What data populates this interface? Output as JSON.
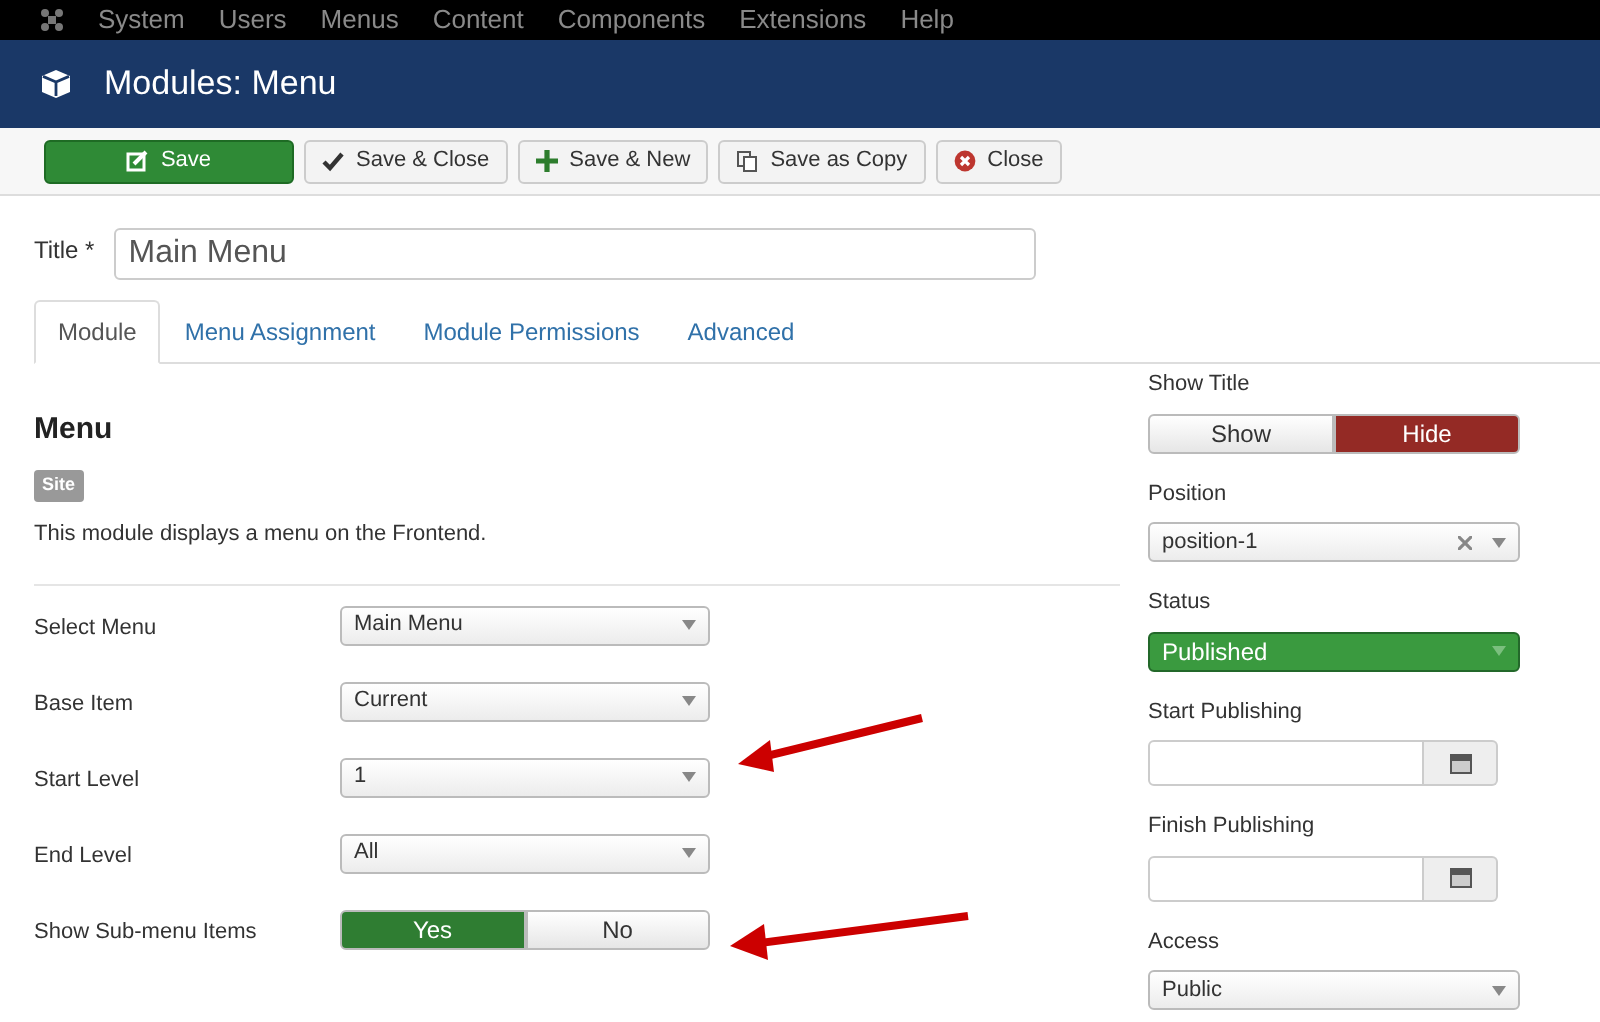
{
  "menu_bar": {
    "items": [
      "System",
      "Users",
      "Menus",
      "Content",
      "Components",
      "Extensions",
      "Help"
    ]
  },
  "header": {
    "title": "Modules: Menu"
  },
  "toolbar": {
    "buttons": [
      {
        "label": "Save",
        "kind": "primary"
      },
      {
        "label": "Save & Close",
        "kind": "default"
      },
      {
        "label": "Save & New",
        "kind": "default"
      },
      {
        "label": "Save as Copy",
        "kind": "default"
      },
      {
        "label": "Close",
        "kind": "default"
      }
    ]
  },
  "title_field": {
    "label": "Title *",
    "value": "Main Menu"
  },
  "tabs": [
    {
      "label": "Module",
      "selected": true
    },
    {
      "label": "Menu Assignment",
      "selected": false
    },
    {
      "label": "Module Permissions",
      "selected": false
    },
    {
      "label": "Advanced",
      "selected": false
    }
  ],
  "module": {
    "heading": "Menu",
    "badge": "Site",
    "description": "This module displays a menu on the Frontend."
  },
  "fields": [
    {
      "kind": "select",
      "label": "Select Menu",
      "value": "Main Menu"
    },
    {
      "kind": "select",
      "label": "Base Item",
      "value": "Current"
    },
    {
      "kind": "select",
      "label": "Start Level",
      "value": "1"
    },
    {
      "kind": "select",
      "label": "End Level",
      "value": "All"
    },
    {
      "kind": "toggle_success",
      "label": "Show Sub-menu Items",
      "options": [
        {
          "label": "Yes",
          "selected": true
        },
        {
          "label": "No",
          "selected": false
        }
      ]
    }
  ],
  "side_fields": [
    {
      "kind": "toggle_danger",
      "label": "Show Title",
      "options": [
        {
          "label": "Show",
          "selected": false
        },
        {
          "label": "Hide",
          "selected": true
        }
      ]
    },
    {
      "kind": "clearable_select",
      "label": "Position",
      "value": "position-1"
    },
    {
      "kind": "status_select",
      "label": "Status",
      "value": "Published"
    },
    {
      "kind": "date",
      "label": "Start Publishing"
    },
    {
      "kind": "date",
      "label": "Finish Publishing"
    },
    {
      "kind": "select",
      "label": "Access",
      "value": "Public"
    }
  ]
}
